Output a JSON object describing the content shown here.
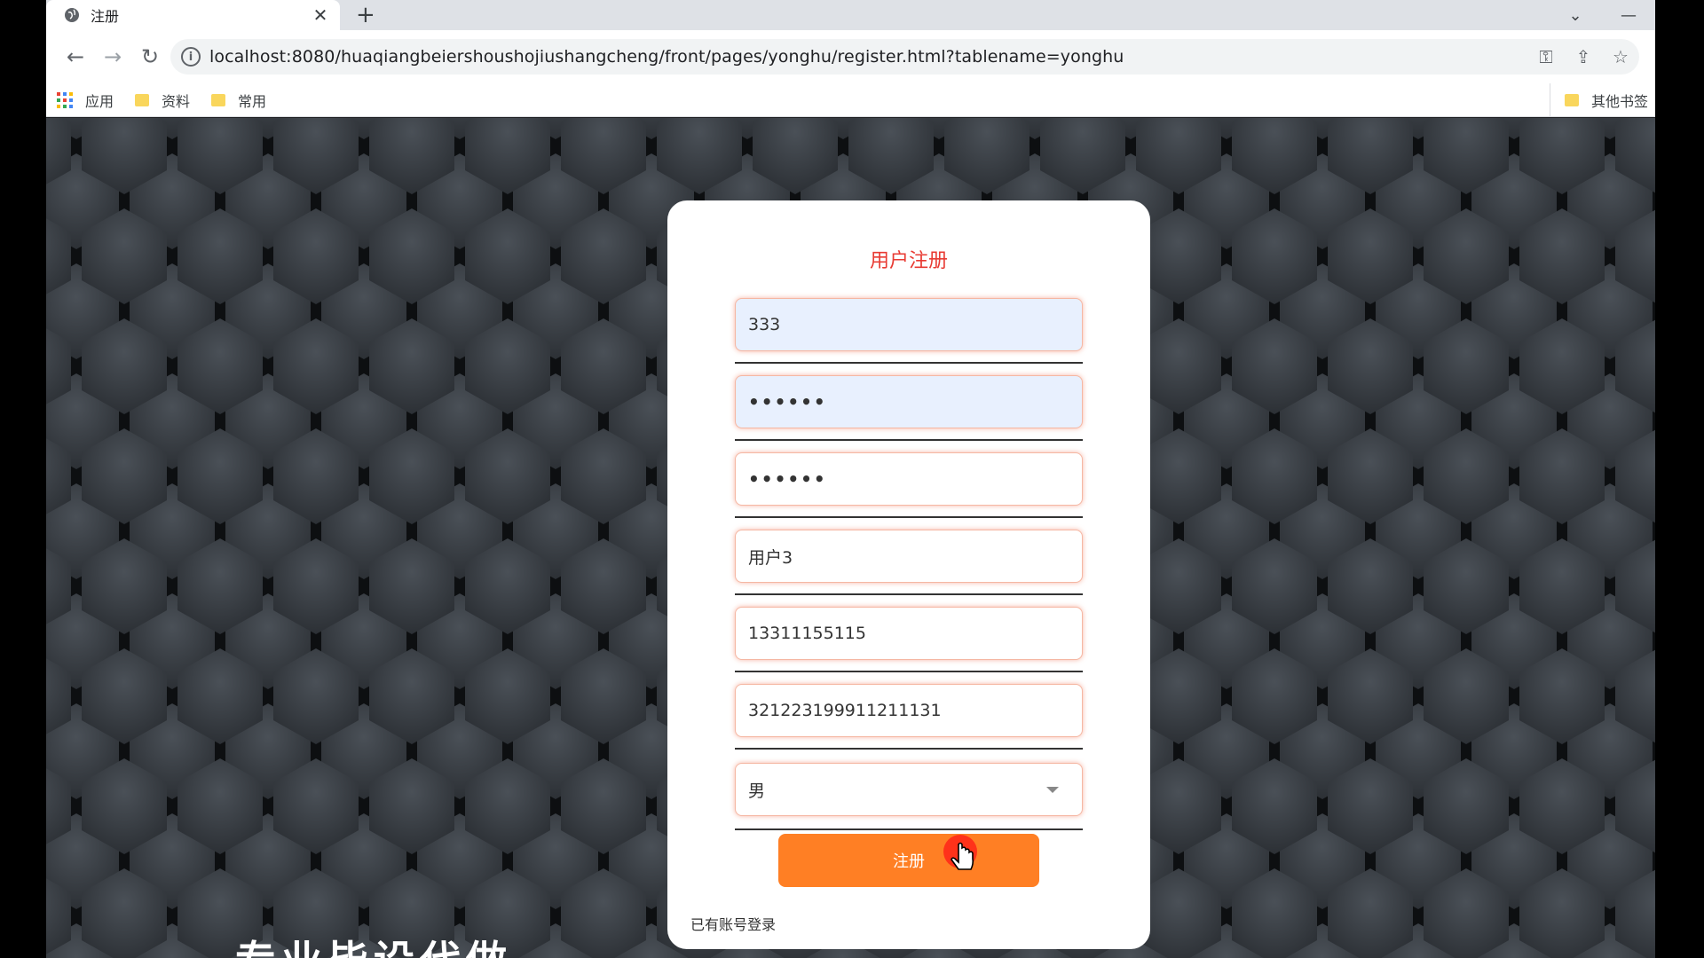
{
  "browser": {
    "tab_title": "注册",
    "new_tab_symbol": "+",
    "url": "localhost:8080/huaqiangbeiershoushojiushangcheng/front/pages/yonghu/register.html?tablename=yonghu"
  },
  "bookmarks": {
    "apps": "应用",
    "items": [
      "资料",
      "常用"
    ],
    "other": "其他书签"
  },
  "form": {
    "title": "用户注册",
    "username": "333",
    "password_mask": "••••••",
    "confirm_password_mask": "••••••",
    "name": "用户3",
    "phone": "13311155115",
    "id_card": "321223199911211131",
    "gender_selected": "男",
    "submit_label": "注册",
    "login_link": "已有账号登录"
  },
  "overlay_text": "专业毕设代做",
  "colors": {
    "title_red": "#e83b33",
    "submit_orange": "#ff7f24",
    "field_glow": "#f5b7a3",
    "autofill_blue": "#e8f0fe",
    "page_bg": "#2a2e33"
  },
  "icons": [
    "globe-icon",
    "close-icon",
    "back-icon",
    "forward-icon",
    "reload-icon",
    "info-icon",
    "key-icon",
    "share-icon",
    "star-icon",
    "apps-icon",
    "folder-icon",
    "chevron-down-icon",
    "minimize-icon",
    "hand-cursor-icon"
  ]
}
